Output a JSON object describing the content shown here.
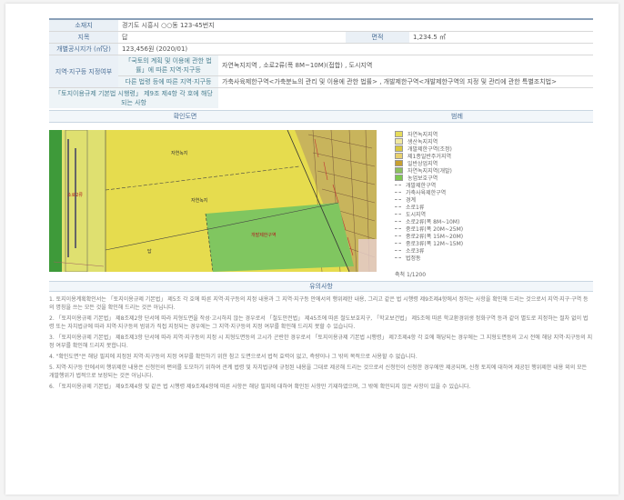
{
  "document": {
    "rows": [
      {
        "label": "소재지",
        "value": "경기도 시흥시 ○○동 123-45번지"
      },
      {
        "label": "지목",
        "value": "답",
        "label2": "면적",
        "value2": "1,234.5 ㎡"
      },
      {
        "label": "개별공시지가 (㎡당)",
        "value": "123,456원 (2020/01)"
      }
    ],
    "zoning": {
      "label": "지역·지구등 지정여부",
      "sub1": {
        "label": "「국토의 계획 및 이용에 관한 법률」에 따른 지역·지구등",
        "value": "자연녹지지역 , 소로2류(폭 8M~10M)(접합) , 도시지역"
      },
      "sub2": {
        "label": "다른 법령 등에 따른 지역·지구등",
        "value": "가축사육제한구역<가축분뇨의 관리 및 이용에 관한 법률> , 개발제한구역<개발제한구역의 지정 및 관리에 관한 특별조치법>"
      }
    },
    "extra": {
      "label": "「토지이용규제 기본법 시행령」 제9조 제4항 각 호에 해당되는 사항",
      "value": ""
    },
    "map_section": {
      "title": "확인도면",
      "legend_title": "범례"
    },
    "map_labels": {
      "top": "자연녹지",
      "center": "자연녹지",
      "green": "개발제한구역",
      "left": "소로2류",
      "bottom": "답"
    },
    "legend": [
      {
        "label": "자연녹지지역",
        "color": "#e6dc5a"
      },
      {
        "label": "생산녹지지역",
        "color": "#f0e8a0"
      },
      {
        "label": "개발제한구역(조정)",
        "color": "#d9c840"
      },
      {
        "label": "제1종일반주거지역",
        "color": "#e8d070"
      },
      {
        "label": "일반상업지역",
        "color": "#c8a030"
      },
      {
        "label": "자연녹지지역(개발)",
        "color": "#8cc060"
      },
      {
        "label": "농업보호구역",
        "color": "#7ec850"
      },
      {
        "label": "개발제한구역",
        "color": ""
      },
      {
        "label": "가축사육제한구역",
        "color": ""
      },
      {
        "label": "경계",
        "color": ""
      },
      {
        "label": "소로1류",
        "color": ""
      },
      {
        "label": "도시지역",
        "color": ""
      },
      {
        "label": "소로2류(폭 8M~10M)",
        "color": ""
      },
      {
        "label": "중로1류(폭 20M~25M)",
        "color": ""
      },
      {
        "label": "중로2류(폭 15M~20M)",
        "color": ""
      },
      {
        "label": "중로3류(폭 12M~15M)",
        "color": ""
      },
      {
        "label": "소로3류",
        "color": ""
      },
      {
        "label": "법정동",
        "color": ""
      }
    ],
    "scale": "축척 1/1200",
    "notes_title": "유의사항",
    "notes": [
      "1. 토지이용계획확인서는 「토지이용규제 기본법」 제5조 각 호에 따른 지역·지구등의 지정 내용과 그 지역·지구등 안에서의 행위제한 내용, 그리고 같은 법 시행령 제9조제4항에서 정하는 사항을 확인해 드리는 것으로서 지역·지구·구역 등의 명칭을 쓰는 모든 것을 확인해 드리는 것은 아닙니다.",
      "2. 「토지이용규제 기본법」 제8조제2항 단서에 따라 지형도면을 작성·고시하지 않는 경우로서 「철도안전법」 제45조에 따른 철도보호지구, 「학교보건법」 제5조에 따른 학교환경위생 정화구역 등과 같이 별도로 지정하는 절차 없이 법령 또는 자치법규에 따라 지역·지구등의 범위가 직접 지정되는 경우에는 그 지역·지구등의 지정 여부를 확인해 드리지 못할 수 있습니다.",
      "3. 「토지이용규제 기본법」 제8조제3항 단서에 따라 지역·지구등의 지정 시 지형도면등의 고시가 곤란한 경우로서 「토지이용규제 기본법 시행령」 제7조제4항 각 호에 해당되는 경우에는 그 지형도면등의 고시 전에 해당 지역·지구등의 지정 여부를 확인해 드리지 못합니다.",
      "4. \"확인도면\"은 해당 필지에 지정된 지역·지구등의 지정 여부를 확인하기 위한 참고 도면으로서 법적 효력이 없고, 측량이나 그 밖의 목적으로 사용할 수 없습니다.",
      "5. 지역·지구등 안에서의 행위제한 내용은 신청인의 편의를 도모하기 위하여 관계 법령 및 자치법규에 규정된 내용을 그대로 제공해 드리는 것으로서 신청인이 신청한 경우에만 제공되며, 신청 토지에 대하여 제공된 행위제한 내용 외의 모든 개발행위가 법적으로 보장되는 것은 아닙니다.",
      "6. 「토지이용규제 기본법」 제9조제4항 및 같은 법 시행령 제9조제4항에 따른 사항은 해당 필지에 대하여 확인된 사항만 기재하였으며, 그 밖에 확인되지 않은 사항이 있을 수 있습니다."
    ]
  }
}
